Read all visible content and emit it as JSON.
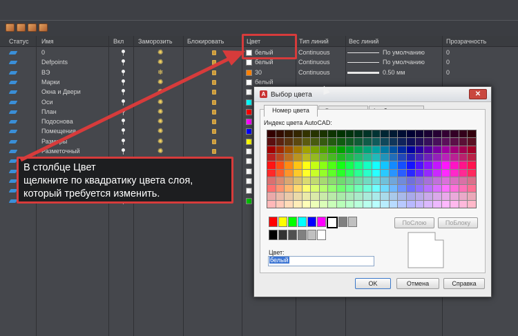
{
  "columns": [
    "Статус",
    "Имя",
    "Вкл",
    "Заморозить",
    "Блокировать",
    "Цвет",
    "Тип линий",
    "Вес линий",
    "Прозрачность"
  ],
  "layers": [
    {
      "name": "0",
      "color_hex": "#ffffff",
      "color_label": "белый",
      "linetype": "Continuous",
      "lineweight": "По умолчанию",
      "lw_thick": false,
      "transparency": "0",
      "freeze": "sun"
    },
    {
      "name": "Defpoints",
      "color_hex": "#ffffff",
      "color_label": "белый",
      "linetype": "Continuous",
      "lineweight": "По умолчанию",
      "lw_thick": false,
      "transparency": "0",
      "freeze": "sun"
    },
    {
      "name": "ВЭ",
      "color_hex": "#ff8000",
      "color_label": "30",
      "linetype": "Continuous",
      "lineweight": "0.50 мм",
      "lw_thick": true,
      "transparency": "0",
      "freeze": "snow"
    },
    {
      "name": "Марки",
      "color_hex": "#ffffff",
      "color_label": "белый",
      "linetype": "",
      "lineweight": "",
      "lw_thick": false,
      "transparency": "",
      "freeze": "sun"
    },
    {
      "name": "Окна и Двери",
      "color_hex": "#ffffff",
      "color_label": "",
      "linetype": "",
      "lineweight": "",
      "lw_thick": false,
      "transparency": "",
      "freeze": "sun"
    },
    {
      "name": "Оси",
      "color_hex": "#00ffff",
      "color_label": "",
      "linetype": "",
      "lineweight": "",
      "lw_thick": false,
      "transparency": "",
      "freeze": "sun"
    },
    {
      "name": "План",
      "color_hex": "#ff0000",
      "color_label": "",
      "linetype": "",
      "lineweight": "",
      "lw_thick": false,
      "transparency": "",
      "freeze": "sun"
    },
    {
      "name": "Подоснова",
      "color_hex": "#ff00ff",
      "color_label": "",
      "linetype": "",
      "lineweight": "",
      "lw_thick": false,
      "transparency": "",
      "freeze": "sun"
    },
    {
      "name": "Помещения",
      "color_hex": "#0000ff",
      "color_label": "",
      "linetype": "",
      "lineweight": "",
      "lw_thick": false,
      "transparency": "",
      "freeze": "sun"
    },
    {
      "name": "Размеры",
      "color_hex": "#ffff00",
      "color_label": "",
      "linetype": "",
      "lineweight": "",
      "lw_thick": false,
      "transparency": "",
      "freeze": "sun"
    },
    {
      "name": "Разметочный",
      "color_hex": "#ffffff",
      "color_label": "",
      "linetype": "",
      "lineweight": "",
      "lw_thick": false,
      "transparency": "",
      "freeze": "sun"
    },
    {
      "name": "",
      "color_hex": "#ffffff",
      "color_label": "",
      "linetype": "",
      "lineweight": "",
      "lw_thick": false,
      "transparency": "",
      "freeze": "sun"
    },
    {
      "name": "",
      "color_hex": "#ffffff",
      "color_label": "",
      "linetype": "",
      "lineweight": "",
      "lw_thick": false,
      "transparency": "",
      "freeze": "sun"
    },
    {
      "name": "",
      "color_hex": "#ffffff",
      "color_label": "",
      "linetype": "",
      "lineweight": "",
      "lw_thick": false,
      "transparency": "",
      "freeze": "sun"
    },
    {
      "name": "",
      "color_hex": "#ffffff",
      "color_label": "",
      "linetype": "",
      "lineweight": "",
      "lw_thick": false,
      "transparency": "",
      "freeze": "sun"
    },
    {
      "name": "",
      "color_hex": "#00c000",
      "color_label": "",
      "linetype": "",
      "lineweight": "",
      "lw_thick": false,
      "transparency": "",
      "freeze": "sun"
    }
  ],
  "callout": {
    "line1": "В столбце Цвет",
    "line2": "щелкните по квадратику цвета слоя,",
    "line3": "который требуется изменить."
  },
  "dialog": {
    "title": "Выбор цвета",
    "tabs": [
      "Номер цвета",
      "Вся палитра",
      "Альбомы цветов"
    ],
    "index_label": "Индекс цвета AutoCAD:",
    "by_layer": "ПоСлою",
    "by_block": "ПоБлоку",
    "color_label": "Цвет:",
    "color_value": "белый",
    "ok": "OK",
    "cancel": "Отмена",
    "help": "Справка",
    "standard_colors": [
      "#ff0000",
      "#ffff00",
      "#00ff00",
      "#00ffff",
      "#0000ff",
      "#ff00ff",
      "#ffffff",
      "#808080",
      "#c0c0c0"
    ],
    "gray_colors": [
      "#000000",
      "#333333",
      "#505050",
      "#808080",
      "#c0c0c0",
      "#ffffff"
    ]
  }
}
